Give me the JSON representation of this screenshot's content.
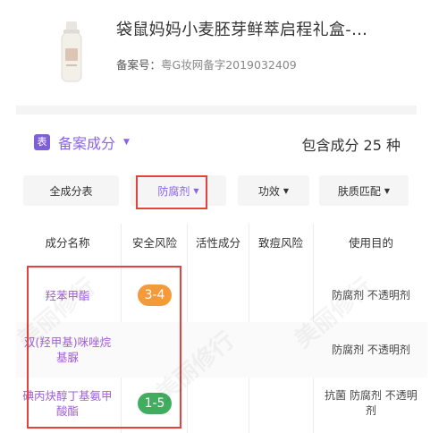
{
  "product": {
    "title": "袋鼠妈妈小麦胚芽鲜萃启程礼盒-…",
    "registration_label": "备案号：",
    "registration_value": "粤G妆网备字2019032409"
  },
  "section": {
    "icon_text": "表",
    "title": "备案成分",
    "count_text": "包含成分 25 种"
  },
  "filters": [
    {
      "label": "全成分表",
      "caret": ""
    },
    {
      "label": "防腐剂",
      "caret": "▼"
    },
    {
      "label": "功效",
      "caret": "▼"
    },
    {
      "label": "肤质匹配",
      "caret": "▼"
    }
  ],
  "table": {
    "headers": [
      "成分名称",
      "安全风险",
      "活性成分",
      "致痘风险",
      "使用目的"
    ],
    "rows": [
      {
        "name": "羟苯甲酯",
        "risk": "3-4",
        "risk_level": "mid",
        "use": "防腐剂 不透明剂"
      },
      {
        "name": "双(羟甲基)咪唑烷基脲",
        "risk": "",
        "risk_level": "",
        "use": "防腐剂 不透明剂"
      },
      {
        "name": "碘丙炔醇丁基氨甲酸酯",
        "risk": "1-5",
        "risk_level": "low",
        "use": "抗菌 防腐剂 不透明剂"
      }
    ]
  },
  "colors": {
    "accent": "#8b64e6",
    "highlight_border": "#e5423e",
    "risk_mid": "#f39a3a",
    "risk_low": "#40ae5e"
  },
  "watermark": "美丽修行"
}
